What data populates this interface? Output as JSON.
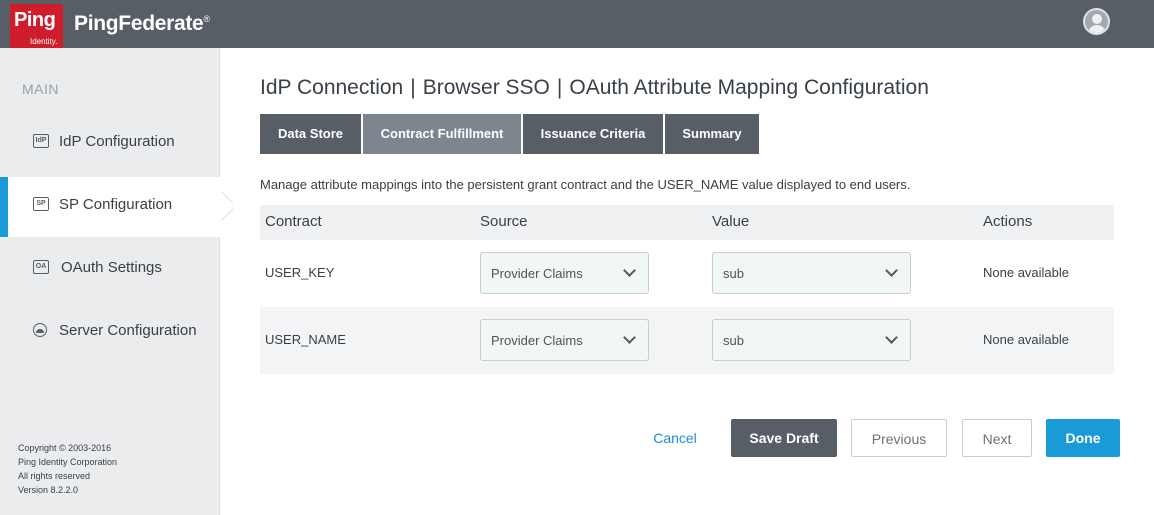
{
  "header": {
    "logo_text": "Ping",
    "logo_sub": "Identity.",
    "brand": "PingFederate",
    "brand_mark": "®"
  },
  "sidebar": {
    "heading": "MAIN",
    "items": [
      {
        "label": "IdP Configuration",
        "icon": "IdP",
        "active": false
      },
      {
        "label": "SP Configuration",
        "icon": "SP",
        "active": true
      },
      {
        "label": "OAuth Settings",
        "icon": "OA",
        "active": false
      },
      {
        "label": "Server Configuration",
        "icon": "server-icon",
        "active": false
      }
    ],
    "copyright": [
      "Copyright © 2003-2016",
      "Ping Identity Corporation",
      "All rights reserved",
      "Version 8.2.2.0"
    ]
  },
  "breadcrumb": [
    "IdP Connection",
    "Browser SSO",
    "OAuth Attribute Mapping Configuration"
  ],
  "tabs": [
    {
      "label": "Data Store",
      "active": false
    },
    {
      "label": "Contract Fulfillment",
      "active": true
    },
    {
      "label": "Issuance Criteria",
      "active": false
    },
    {
      "label": "Summary",
      "active": false
    }
  ],
  "description": "Manage attribute mappings into the persistent grant contract and the USER_NAME value displayed to end users.",
  "table": {
    "headers": [
      "Contract",
      "Source",
      "Value",
      "Actions"
    ],
    "rows": [
      {
        "contract": "USER_KEY",
        "source": "Provider Claims",
        "value": "sub",
        "actions": "None available"
      },
      {
        "contract": "USER_NAME",
        "source": "Provider Claims",
        "value": "sub",
        "actions": "None available"
      }
    ]
  },
  "buttons": {
    "cancel": "Cancel",
    "save_draft": "Save Draft",
    "previous": "Previous",
    "next": "Next",
    "done": "Done"
  },
  "colors": {
    "header": "#575e66",
    "logo": "#cf1d2c",
    "accent": "#1a9bd7",
    "sidebar": "#ebecee"
  }
}
